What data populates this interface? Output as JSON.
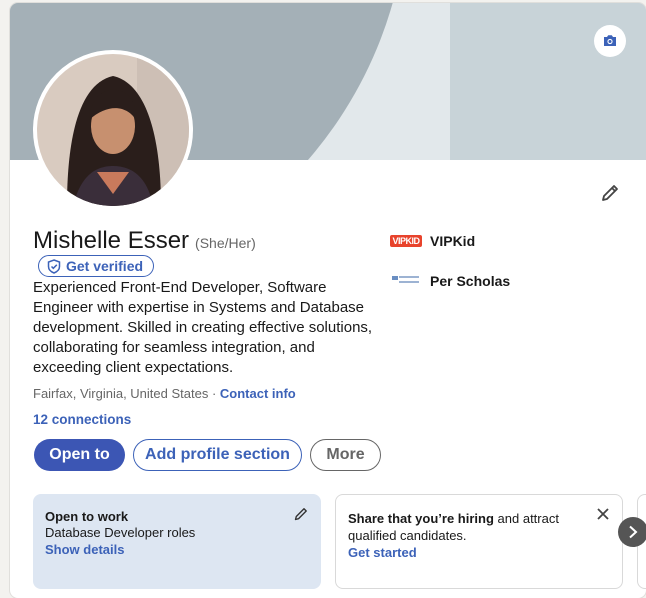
{
  "profile": {
    "name": "Mishelle Esser",
    "pronouns": "(She/Her)",
    "verify_label": "Get verified",
    "headline": "Experienced Front-End Developer, Software Engineer with expertise in Systems and Database development. Skilled in creating effective solutions, collaborating for seamless integration, and exceeding client expectations.",
    "location": "Fairfax, Virginia, United States",
    "location_sep": " · ",
    "contact_label": "Contact info",
    "connections": "12 connections"
  },
  "actions": {
    "open_to": "Open to",
    "add_section": "Add profile section",
    "more": "More"
  },
  "experience": [
    {
      "name": "VIPKid",
      "logo_text": "VIPKID"
    },
    {
      "name": "Per Scholas",
      "logo_text": "PER SCHOLAS"
    }
  ],
  "cards": {
    "open_to_work": {
      "title": "Open to work",
      "roles": "Database Developer roles",
      "link": "Show details"
    },
    "hiring": {
      "title_bold": "Share that you’re hiring",
      "title_rest": " and attract qualified candidates.",
      "link": "Get started"
    }
  },
  "icons": {
    "camera": "camera-icon",
    "edit": "pencil-icon",
    "shield": "shield-check-icon",
    "close": "close-icon",
    "next": "chevron-right-icon"
  },
  "colors": {
    "accent": "#3c62b8",
    "primary_button": "#3c56b4",
    "open_to_work_bg": "#dde6f2"
  }
}
